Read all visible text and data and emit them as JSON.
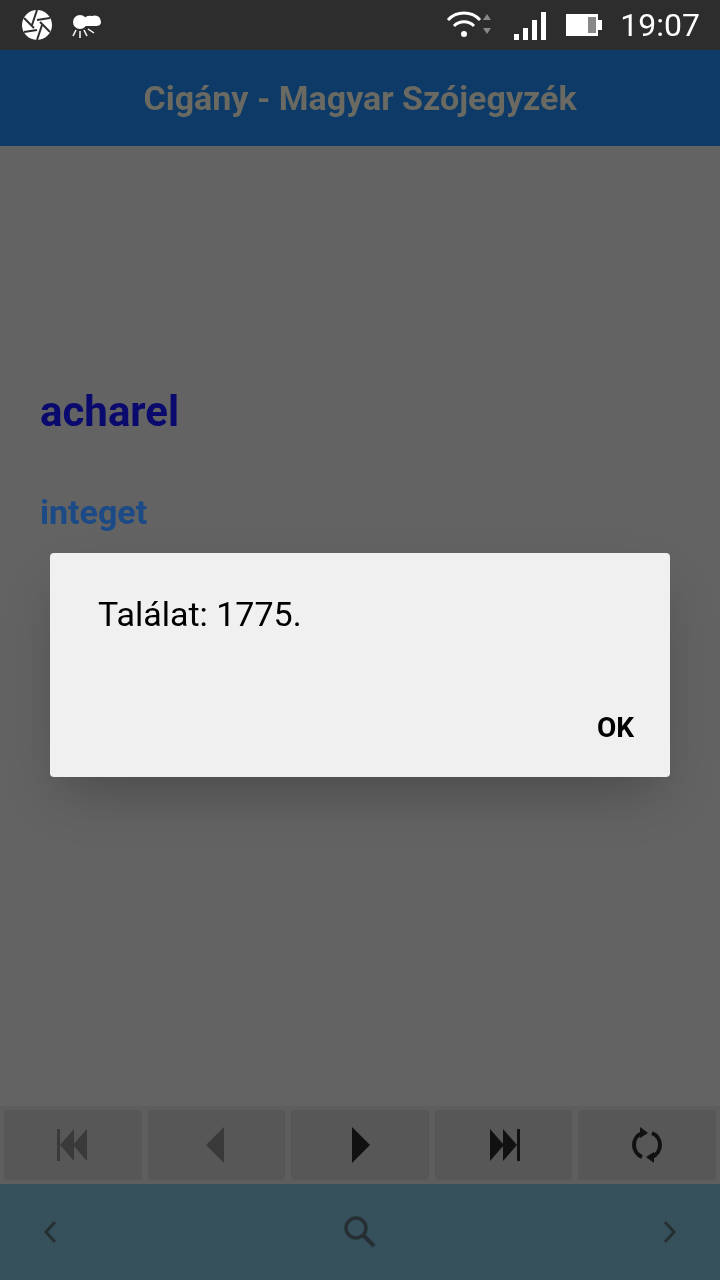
{
  "status_bar": {
    "time": "19:07"
  },
  "app_bar": {
    "title": "Cigány - Magyar Szójegyzék"
  },
  "entry": {
    "word": "acharel",
    "translation": "integet"
  },
  "dialog": {
    "message": "Találat: 1775.",
    "button": "OK"
  },
  "controls": [
    {
      "kind": "first",
      "disabled": true
    },
    {
      "kind": "prev",
      "disabled": true
    },
    {
      "kind": "next",
      "disabled": false
    },
    {
      "kind": "last",
      "disabled": false
    },
    {
      "kind": "refresh",
      "disabled": false
    }
  ],
  "bottom_nav": [
    {
      "kind": "back"
    },
    {
      "kind": "search"
    },
    {
      "kind": "forward"
    }
  ]
}
